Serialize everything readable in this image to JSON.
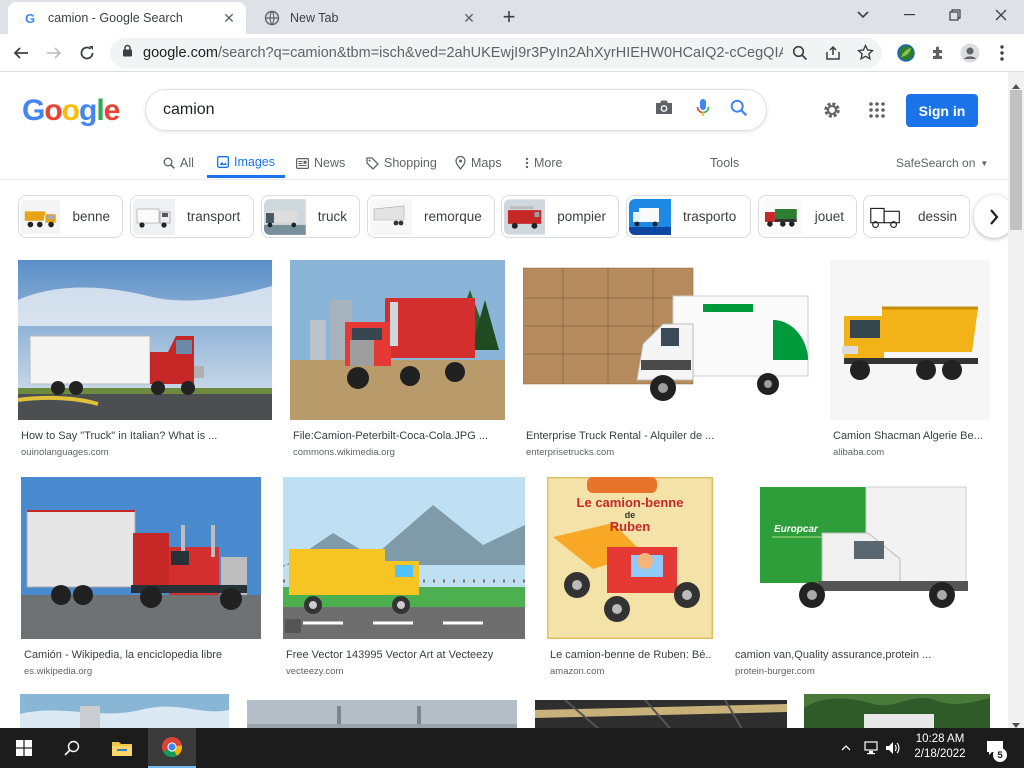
{
  "browser": {
    "tabs": [
      {
        "title": "camion - Google Search",
        "active": true
      },
      {
        "title": "New Tab",
        "active": false
      }
    ],
    "new_tab_symbol": "+",
    "url_host": "google.com",
    "url_rest": "/search?q=camion&tbm=isch&ved=2ahUKEwjI9r3PyIn2AhXyrHIEHW0HCaIQ2-cCegQIAB..."
  },
  "google": {
    "logo_letters": [
      "G",
      "o",
      "o",
      "g",
      "l",
      "e"
    ],
    "logo_colors": [
      "#4285f4",
      "#ea4335",
      "#fbbc05",
      "#4285f4",
      "#34a853",
      "#ea4335"
    ],
    "query": "camion",
    "sign_in_label": "Sign in",
    "nav_tabs": [
      {
        "label": "All",
        "icon": "search-icon"
      },
      {
        "label": "Images",
        "icon": "image-icon",
        "selected": true
      },
      {
        "label": "News",
        "icon": "news-icon"
      },
      {
        "label": "Shopping",
        "icon": "tag-icon"
      },
      {
        "label": "Maps",
        "icon": "pin-icon"
      },
      {
        "label": "More",
        "icon": "more-vert-icon"
      }
    ],
    "tools_label": "Tools",
    "safesearch_label": "SafeSearch on"
  },
  "chips": [
    "benne",
    "transport",
    "truck",
    "remorque",
    "pompier",
    "trasporto",
    "jouet",
    "dessin"
  ],
  "results": [
    {
      "caption": "How to Say \"Truck\" in Italian? What is ...",
      "source": "ouinolanguages.com"
    },
    {
      "caption": "File:Camion-Peterbilt-Coca-Cola.JPG ...",
      "source": "commons.wikimedia.org"
    },
    {
      "caption": "Enterprise Truck Rental - Alquiler de ...",
      "source": "enterprisetrucks.com"
    },
    {
      "caption": "Camion Shacman Algerie Be...",
      "source": "alibaba.com"
    },
    {
      "caption": "Camión - Wikipedia, la enciclopedia libre",
      "source": "es.wikipedia.org"
    },
    {
      "caption": "Free Vector 143995 Vector Art at Vecteezy",
      "source": "vecteezy.com"
    },
    {
      "caption": "Le camion-benne de Ruben: Bé...",
      "source": "amazon.com"
    },
    {
      "caption": "camion van,Quality assurance,protein ...",
      "source": "protein-burger.com"
    }
  ],
  "book_cover": {
    "line1": "Le camion-benne",
    "line2": "de",
    "line3": "Ruben"
  },
  "van_brand": "Europcar",
  "taskbar": {
    "time": "10:28 AM",
    "date": "2/18/2022",
    "notification_count": "5"
  }
}
